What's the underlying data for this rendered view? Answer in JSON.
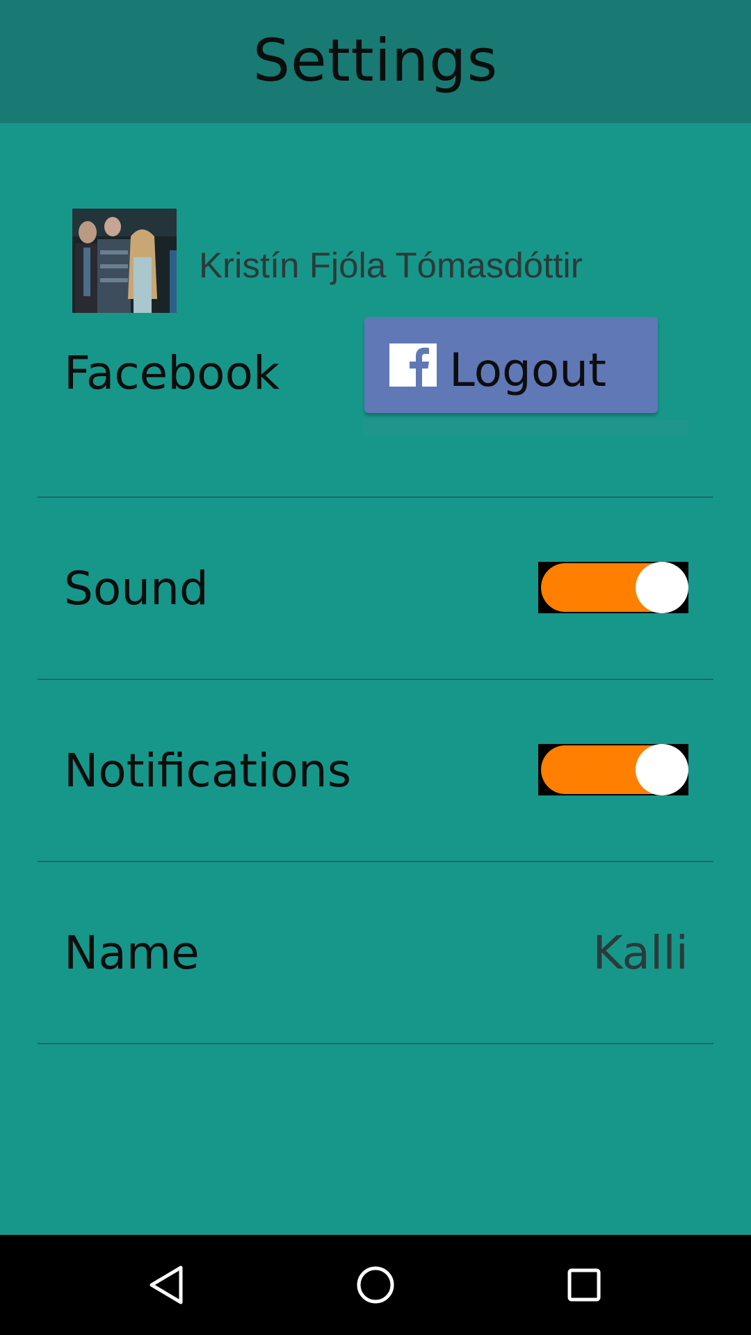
{
  "header": {
    "title": "Settings"
  },
  "facebook": {
    "profile_name": "Kristín Fjóla Tómasdóttir",
    "label": "Facebook",
    "button_label": "Logout",
    "button_color": "#6078B6"
  },
  "settings": {
    "sound": {
      "label": "Sound",
      "enabled": true
    },
    "notifications": {
      "label": "Notifications",
      "enabled": true
    },
    "name": {
      "label": "Name",
      "value": "Kalli"
    }
  },
  "colors": {
    "background": "#17978A",
    "header": "#187A73",
    "toggle_on": "#FF7F00",
    "navbar": "#000000"
  },
  "navbar": {
    "icons": [
      "back-icon",
      "home-icon",
      "recents-icon"
    ]
  }
}
